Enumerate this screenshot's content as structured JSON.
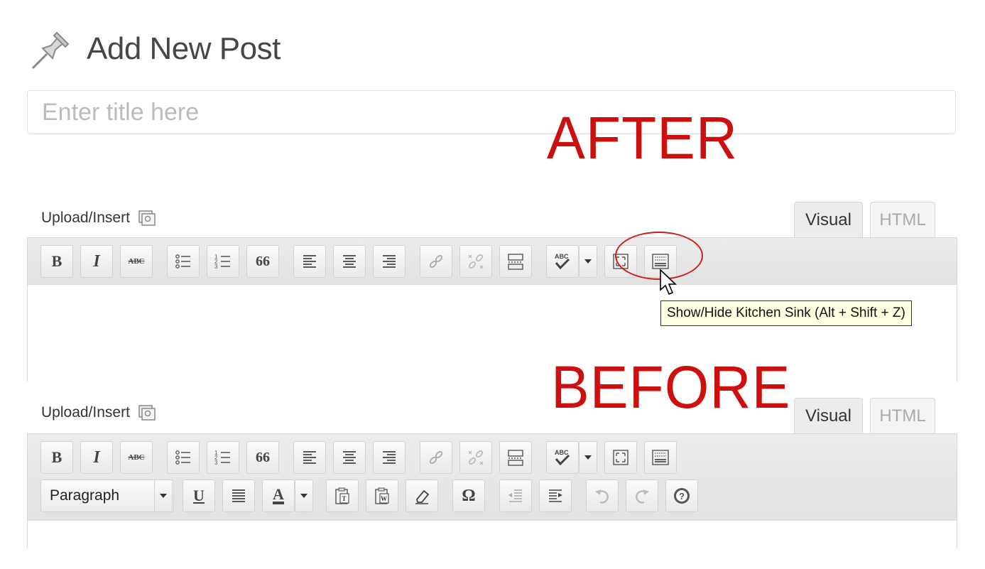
{
  "page": {
    "title": "Add New Post"
  },
  "title_field": {
    "placeholder": "Enter title here"
  },
  "annotations": {
    "after": "AFTER",
    "before": "BEFORE"
  },
  "editor": {
    "upload_insert_label": "Upload/Insert",
    "tabs": {
      "visual": "Visual",
      "html": "HTML"
    }
  },
  "toolbar_row1": {
    "bold": "B",
    "italic": "I",
    "strikethrough": "ABC",
    "blockquote": "66",
    "spellcheck": "ABC"
  },
  "toolbar_row2": {
    "format_select": "Paragraph",
    "underline": "U",
    "text_color": "A",
    "special_char": "Ω"
  },
  "tooltip": {
    "kitchen_sink": "Show/Hide Kitchen Sink (Alt + Shift + Z)"
  },
  "colors": {
    "annotation_red": "#cc1010",
    "circle_red": "#cc2020",
    "tooltip_bg": "#ffffe1"
  }
}
